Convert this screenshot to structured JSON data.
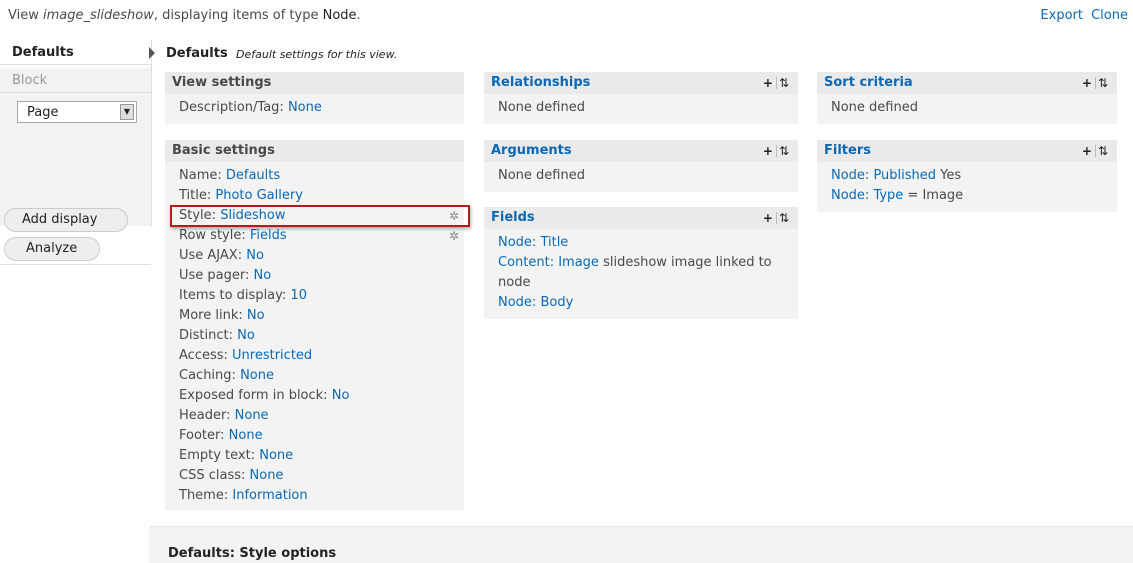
{
  "top": {
    "prefix": "View ",
    "view_name": "image_slideshow",
    "middle": ", displaying items of type ",
    "type": "Node",
    "suffix": ".",
    "export": "Export",
    "clone": "Clone"
  },
  "tabs": {
    "defaults": "Defaults",
    "block": "Block",
    "display_select": "Page",
    "add_display": "Add display",
    "analyze": "Analyze"
  },
  "heading": {
    "title": "Defaults",
    "subtitle": "Default settings for this view."
  },
  "view_settings": {
    "title": "View settings",
    "description": {
      "label": "Description/Tag:",
      "value": "None"
    }
  },
  "basic_settings": {
    "title": "Basic settings",
    "rows": [
      {
        "label": "Name:",
        "value": "Defaults"
      },
      {
        "label": "Title:",
        "value": "Photo Gallery"
      },
      {
        "label": "Style:",
        "value": "Slideshow"
      },
      {
        "label": "Row style:",
        "value": "Fields"
      },
      {
        "label": "Use AJAX:",
        "value": "No"
      },
      {
        "label": "Use pager:",
        "value": "No"
      },
      {
        "label": "Items to display:",
        "value": "10"
      },
      {
        "label": "More link:",
        "value": "No"
      },
      {
        "label": "Distinct:",
        "value": "No"
      },
      {
        "label": "Access:",
        "value": "Unrestricted"
      },
      {
        "label": "Caching:",
        "value": "None"
      },
      {
        "label": "Exposed form in block:",
        "value": "No"
      },
      {
        "label": "Header:",
        "value": "None"
      },
      {
        "label": "Footer:",
        "value": "None"
      },
      {
        "label": "Empty text:",
        "value": "None"
      },
      {
        "label": "CSS class:",
        "value": "None"
      },
      {
        "label": "Theme:",
        "value": "Information"
      }
    ]
  },
  "relationships": {
    "title": "Relationships",
    "empty": "None defined"
  },
  "arguments": {
    "title": "Arguments",
    "empty": "None defined"
  },
  "fields": {
    "title": "Fields",
    "items": [
      {
        "link": "Node: Title",
        "rest": ""
      },
      {
        "link": "Content: Image",
        "rest": " slideshow image linked to node"
      },
      {
        "link": "Node: Body",
        "rest": ""
      }
    ]
  },
  "sort_criteria": {
    "title": "Sort criteria",
    "empty": "None defined"
  },
  "filters": {
    "title": "Filters",
    "items": [
      {
        "link": "Node: Published",
        "rest": " Yes"
      },
      {
        "link": "Node: Type",
        "rest": " = Image"
      }
    ]
  },
  "controls": {
    "add": "+",
    "rearrange": "⇅",
    "gear": "✲"
  },
  "bottom": {
    "title": "Defaults: Style options"
  }
}
